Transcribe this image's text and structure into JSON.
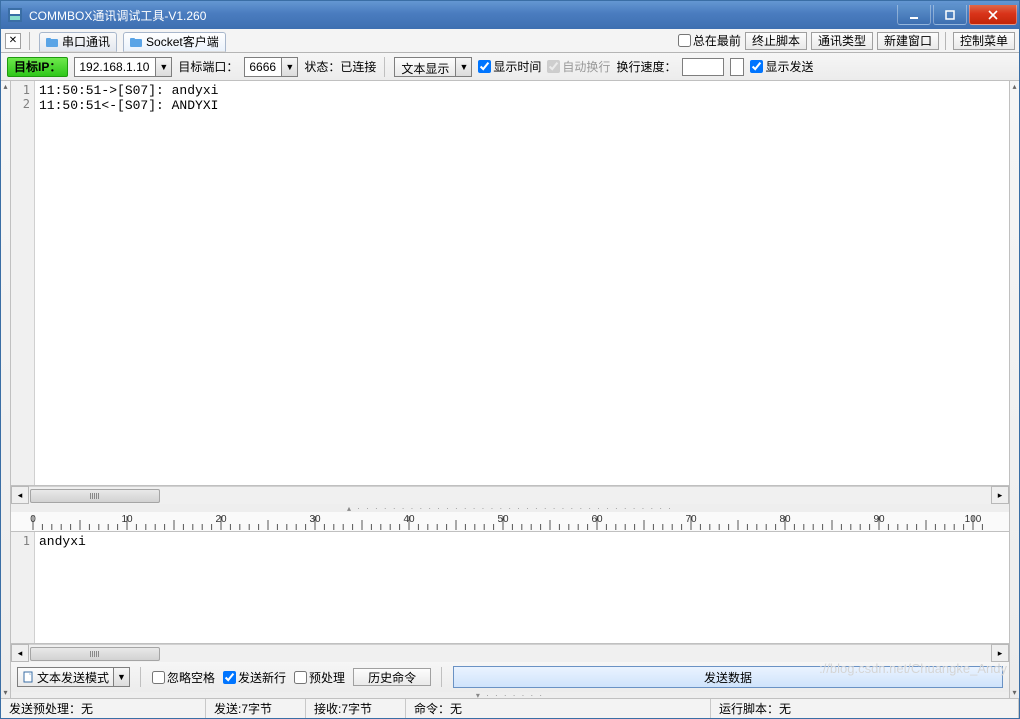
{
  "title": "COMMBOX通讯调试工具-V1.260",
  "tabs": {
    "serial": "串口通讯",
    "socket": "Socket客户端"
  },
  "topcheck": {
    "alwaysfront": "总在最前"
  },
  "topbuttons": {
    "stopscript": "终止脚本",
    "commtype": "通讯类型",
    "newwindow": "新建窗口",
    "ctrlmenu": "控制菜单"
  },
  "toolbar": {
    "targetip_btn": "目标IP：",
    "targetip_val": "192.168.1.10",
    "port_label": "目标端口：",
    "port_val": "6666",
    "status_label": "状态：",
    "status_val": "已连接",
    "textshow": "文本显示",
    "showtime": "显示时间",
    "autowrap": "自动换行",
    "wrapspeed": "换行速度：",
    "showsend": "显示发送"
  },
  "log": [
    "11:50:51->[S07]: andyxi",
    "11:50:51<-[S07]: ANDYXI"
  ],
  "sendtext": "andyxi",
  "sendbar": {
    "mode": "文本发送模式",
    "ignorespace": "忽略空格",
    "sendnewline": "发送新行",
    "preprocess": "预处理",
    "history": "历史命令",
    "send": "发送数据"
  },
  "status": {
    "pre": "发送预处理：无",
    "sent": "发送:7字节",
    "recv": "接收:7字节",
    "cmd": "命令：无",
    "script": "运行脚本：无"
  },
  "watermark": "://blog.csdn.net/Chuangke_Andy"
}
